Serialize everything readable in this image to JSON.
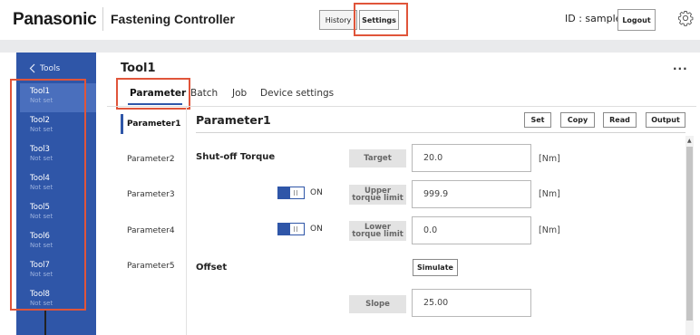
{
  "header": {
    "brand": "Panasonic",
    "app_title": "Fastening Controller",
    "history_label": "History",
    "settings_label": "Settings",
    "user_id": "ID : sample",
    "logout_label": "Logout"
  },
  "sidebar": {
    "back_label": "Tools",
    "items": [
      {
        "name": "Tool1",
        "status": "Not set"
      },
      {
        "name": "Tool2",
        "status": "Not set"
      },
      {
        "name": "Tool3",
        "status": "Not set"
      },
      {
        "name": "Tool4",
        "status": "Not set"
      },
      {
        "name": "Tool5",
        "status": "Not set"
      },
      {
        "name": "Tool6",
        "status": "Not set"
      },
      {
        "name": "Tool7",
        "status": "Not set"
      },
      {
        "name": "Tool8",
        "status": "Not set"
      }
    ]
  },
  "main": {
    "title": "Tool1",
    "more": "...",
    "tabs": [
      "Parameter",
      "Batch",
      "Job",
      "Device settings"
    ],
    "params": [
      "Parameter1",
      "Parameter2",
      "Parameter3",
      "Parameter4",
      "Parameter5"
    ],
    "section_title": "Parameter1",
    "actions": {
      "set": "Set",
      "copy": "Copy",
      "read": "Read",
      "output": "Output"
    },
    "shutoff_label": "Shut-off Torque",
    "offset_label": "Offset",
    "toggle_on": "ON",
    "fields": {
      "target": {
        "label": "Target",
        "value": "20.0",
        "unit": "[Nm]"
      },
      "upper": {
        "label": "Upper torque limit",
        "value": "999.9",
        "unit": "[Nm]"
      },
      "lower": {
        "label": "Lower torque limit",
        "value": "0.0",
        "unit": "[Nm]"
      },
      "slope": {
        "label": "Slope",
        "value": "25.00"
      }
    },
    "simulate_label": "Simulate"
  },
  "colors": {
    "sidebar": "#2f56a8",
    "highlight": "#e0553a",
    "accent": "#2f56a8"
  }
}
